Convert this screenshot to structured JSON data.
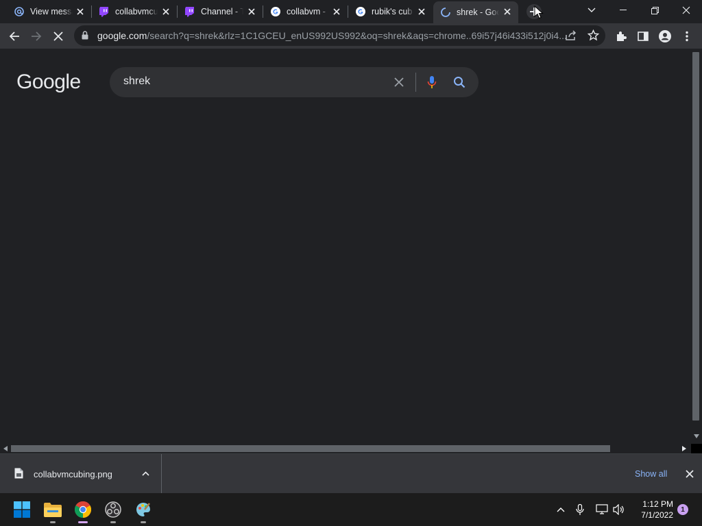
{
  "tabs": [
    {
      "title": "View messa",
      "icon": "mail-at-icon"
    },
    {
      "title": "collabvmcu",
      "icon": "twitch-icon"
    },
    {
      "title": "Channel - T",
      "icon": "twitch-icon"
    },
    {
      "title": "collabvm -",
      "icon": "google-icon"
    },
    {
      "title": "rubik's cub",
      "icon": "google-icon"
    },
    {
      "title": "shrek - Goo",
      "icon": "loading-icon",
      "active": true
    }
  ],
  "toolbar": {
    "url_host": "google.com",
    "url_path": "/search?q=shrek&rlz=1C1GCEU_enUS992US992&oq=shrek&aqs=chrome..69i57j46i433i512j0i4..."
  },
  "page": {
    "logo": "Google",
    "search_value": "shrek"
  },
  "downloads": {
    "file_name": "collabvmcubing.png",
    "show_all": "Show all"
  },
  "taskbar": {
    "time": "1:12 PM",
    "date": "7/1/2022",
    "notification_count": "1"
  },
  "colors": {
    "accent_link": "#8ab4f8",
    "twitch": "#9146ff",
    "google_blue": "#4285f4"
  }
}
